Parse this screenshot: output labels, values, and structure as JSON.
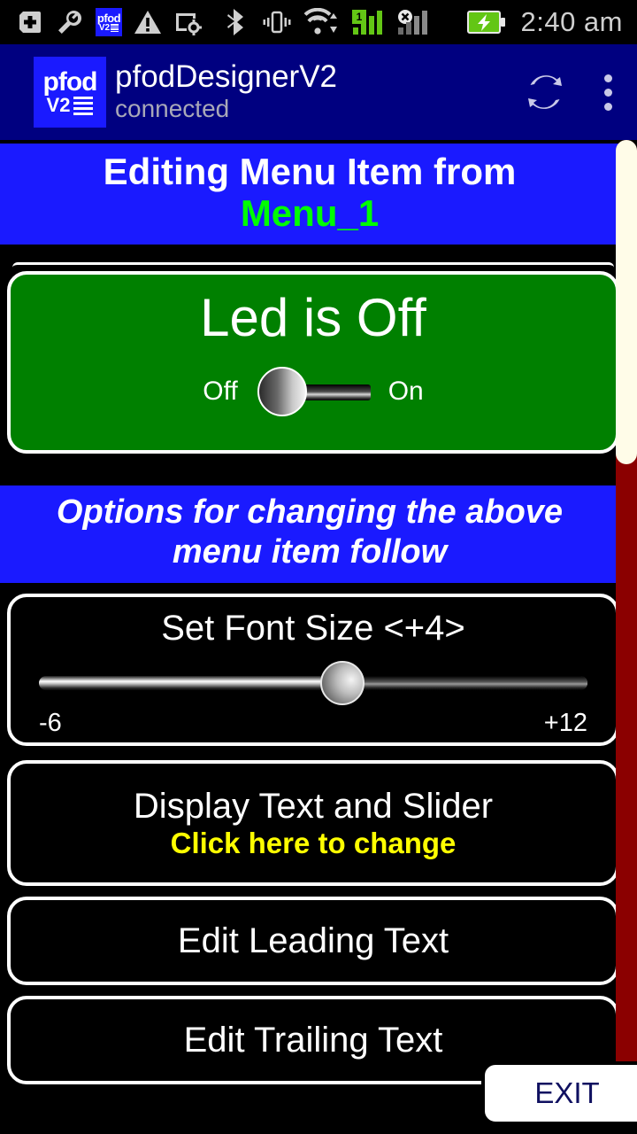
{
  "status_bar": {
    "icons": [
      "add-shape-icon",
      "wrench-icon",
      "pfod-v2-icon",
      "warning-triangle-icon",
      "screen-settings-icon",
      "bluetooth-icon",
      "vibrate-icon",
      "wifi-icon",
      "signal-bars-sim1-icon",
      "signal-no-service-icon",
      "battery-charging-icon"
    ],
    "pfod_badge": {
      "line1": "pfod",
      "line2": "V2"
    },
    "sim_badge": "1",
    "time": "2:40 am"
  },
  "app_bar": {
    "logo": {
      "line1": "pfod",
      "line2": "V2"
    },
    "title": "pfodDesignerV2",
    "subtitle": "connected",
    "refresh_icon": "refresh-icon",
    "overflow_icon": "overflow-menu-icon"
  },
  "header_banner": {
    "line1": "Editing Menu Item from",
    "line2": "Menu_1"
  },
  "preview": {
    "title": "Led is Off",
    "toggle": {
      "off_label": "Off",
      "on_label": "On",
      "state": "off"
    }
  },
  "options_banner": {
    "line1": "Options for changing the above",
    "line2": "menu item follow"
  },
  "options": {
    "font_size": {
      "title": "Set Font Size <+4>",
      "value": "+4",
      "min_label": "-6",
      "max_label": "+12",
      "min": -6,
      "max": 12,
      "percent": 55
    },
    "display_text": {
      "title": "Display Text and Slider",
      "subtitle": "Click here to change"
    },
    "leading_text": {
      "title": "Edit Leading Text"
    },
    "trailing_text": {
      "title": "Edit Trailing Text"
    }
  },
  "exit_button": {
    "label": "EXIT"
  },
  "colors": {
    "app_bar": "#000080",
    "banner_blue": "#1a1aff",
    "accent_green": "#00ff00",
    "panel_green": "#008000",
    "accent_yellow": "#ffff00",
    "scrollbar_track": "#8b0000",
    "scrollbar_thumb": "#fffce8"
  }
}
